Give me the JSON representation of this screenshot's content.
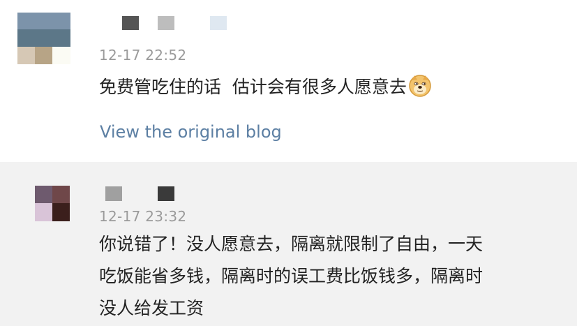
{
  "comments": [
    {
      "timestamp": "12-17 22:52",
      "text": "免费管吃住的话  估计会有很多人愿意去",
      "emoji": "doge-emoji",
      "link": "View the original blog",
      "avatar_colors": [
        "#7c93aa",
        "#7c93aa",
        "#7c93aa",
        "#5c7788",
        "#5c7788",
        "#5c7788",
        "#d6c8b5",
        "#b7a486",
        "#fbfbf4"
      ],
      "name_blocks": [
        "#555555",
        "#bdbdbd",
        "#dfe8f1"
      ]
    },
    {
      "timestamp": "12-17 23:32",
      "text_lines": [
        "你说错了！没人愿意去，隔离就限制了自由，一天",
        "吃饭能省多钱，隔离时的误工费比饭钱多，隔离时",
        "没人给发工资"
      ],
      "avatar_colors": [
        "#6e5a6e",
        "#6f4749",
        "#d9c4d8",
        "#3b1f1c"
      ],
      "name_blocks": [
        "#a0a0a0",
        "#3a3a3a"
      ]
    }
  ]
}
